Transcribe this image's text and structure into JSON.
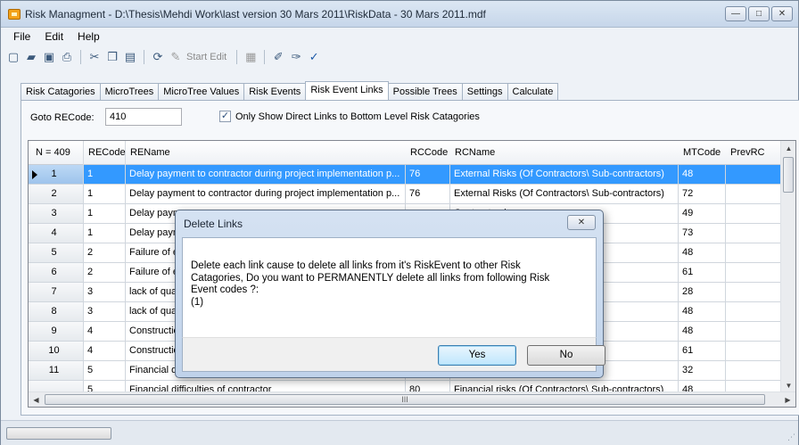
{
  "window": {
    "title": "Risk Managment - D:\\Thesis\\Mehdi Work\\last version 30 Mars 2011\\RiskData - 30 Mars 2011.mdf",
    "minimize": "—",
    "maximize": "□",
    "close": "✕"
  },
  "menu": [
    "File",
    "Edit",
    "Help"
  ],
  "toolbar": {
    "start_edit": "Start Edit",
    "icons": [
      "new-icon",
      "open-icon",
      "save-icon",
      "print-icon",
      "cut-icon",
      "copy-icon",
      "paste-icon",
      "refresh-icon",
      "pencil-icon",
      "calculator-icon",
      "edit-links-icon",
      "remove-links-icon",
      "check-icon"
    ]
  },
  "tabs": [
    "Risk Catagories",
    "MicroTrees",
    "MicroTree Values",
    "Risk Events",
    "Risk Event Links",
    "Possible Trees",
    "Settings",
    "Calculate"
  ],
  "active_tab": "Risk Event Links",
  "goto": {
    "label": "Goto RECode:",
    "value": "410"
  },
  "filter": {
    "label": "Only Show Direct Links to Bottom Level Risk Catagories",
    "checked": true
  },
  "grid": {
    "columns": [
      "N = 409",
      "RECode",
      "REName",
      "RCCode",
      "RCName",
      "MTCode",
      "PrevRC"
    ],
    "rows": [
      {
        "n": "1",
        "recode": "1",
        "rename": "Delay payment to contractor during project implementation p...",
        "rccode": "76",
        "rcname": "External Risks (Of Contractors\\ Sub-contractors)",
        "mtcode": "48",
        "prevrc": ""
      },
      {
        "n": "2",
        "recode": "1",
        "rename": "Delay payment to contractor during project implementation p...",
        "rccode": "76",
        "rcname": "External Risks (Of Contractors\\ Sub-contractors)",
        "mtcode": "72",
        "prevrc": ""
      },
      {
        "n": "3",
        "recode": "1",
        "rename": "Delay paym",
        "rccode": "",
        "rcname": "Contractors\\ ...",
        "mtcode": "49",
        "prevrc": ""
      },
      {
        "n": "4",
        "recode": "1",
        "rename": "Delay paym",
        "rccode": "",
        "rcname": "Contractors\\ ...",
        "mtcode": "73",
        "prevrc": ""
      },
      {
        "n": "5",
        "recode": "2",
        "rename": "Failure of e",
        "rccode": "",
        "rcname": "ontractors)",
        "mtcode": "48",
        "prevrc": ""
      },
      {
        "n": "6",
        "recode": "2",
        "rename": "Failure of e",
        "rccode": "",
        "rcname": "actor in task ...",
        "mtcode": "61",
        "prevrc": ""
      },
      {
        "n": "7",
        "recode": "3",
        "rename": "lack of qua",
        "rccode": "",
        "rcname": "f labor and ...",
        "mtcode": "28",
        "prevrc": ""
      },
      {
        "n": "8",
        "recode": "3",
        "rename": "lack of qua",
        "rccode": "",
        "rcname": "ontractors)",
        "mtcode": "48",
        "prevrc": ""
      },
      {
        "n": "9",
        "recode": "4",
        "rename": "Constructio",
        "rccode": "",
        "rcname": "ontractors)",
        "mtcode": "48",
        "prevrc": ""
      },
      {
        "n": "10",
        "recode": "4",
        "rename": "Constructio",
        "rccode": "",
        "rcname": "ctor in task ...",
        "mtcode": "61",
        "prevrc": ""
      },
      {
        "n": "11",
        "recode": "5",
        "rename": "Financial d",
        "rccode": "",
        "rcname": "es) in implem...",
        "mtcode": "32",
        "prevrc": ""
      },
      {
        "n": "",
        "recode": "5",
        "rename": "Financial difficulties of contractor",
        "rccode": "80",
        "rcname": "Financial risks (Of Contractors\\ Sub-contractors)",
        "mtcode": "48",
        "prevrc": ""
      }
    ],
    "selected_row": 0,
    "hscroll_label": "III"
  },
  "dialog": {
    "title": "Delete Links",
    "close": "✕",
    "message": "Delete each link cause to delete all links from it's RiskEvent to other Risk Catagories, Do you want to PERMANENTLY delete all links from following Risk Event codes  ?:",
    "codes": "(1)",
    "yes": "Yes",
    "no": "No"
  },
  "colors": {
    "selection": "#3399ff",
    "accent": "#1e5aa8"
  }
}
